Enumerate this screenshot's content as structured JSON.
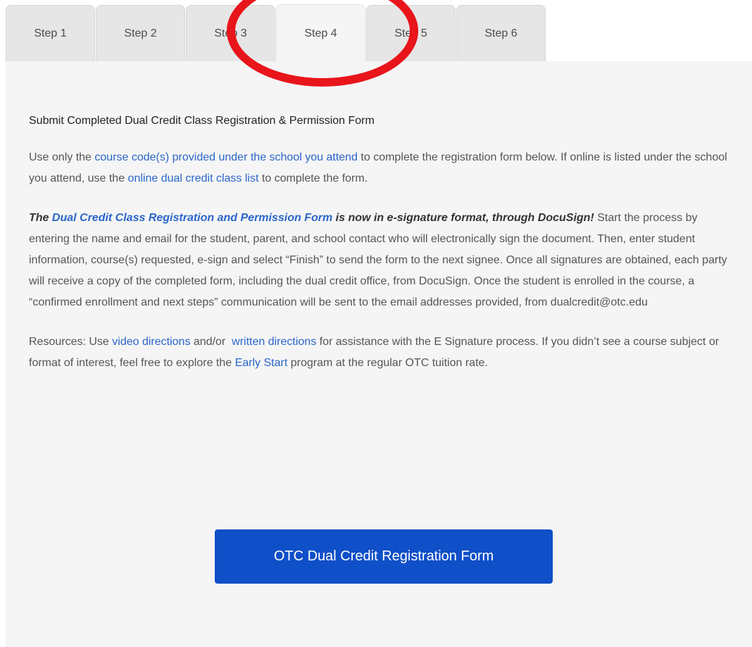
{
  "tabs": [
    {
      "label": "Step 1"
    },
    {
      "label": "Step 2"
    },
    {
      "label": "Step 3"
    },
    {
      "label": "Step 4"
    },
    {
      "label": "Step 5"
    },
    {
      "label": "Step 6"
    }
  ],
  "active_tab": "Step 4",
  "content": {
    "heading": "Submit Completed Dual Credit Class Registration & Permission Form",
    "p1": {
      "t1": "Use only the ",
      "link1": "course code(s) provided under the school you attend",
      "t2": " to complete the registration form below. If online is listed under the school you attend, use the ",
      "link2": "online dual credit class list",
      "t3": " to complete the form."
    },
    "p2": {
      "em1": "The ",
      "link": "Dual Credit Class Registration and Permission Form",
      "em2": " is now in e-signature format, through DocuSign!",
      "text": " Start the process by entering the name and email for the student, parent, and school contact who will electronically sign the document. Then, enter student information, course(s) requested, e-sign and select “Finish” to send the form to the next signee. Once all signatures are obtained, each party will receive a copy of the completed form, including the dual credit office, from DocuSign. Once the student is enrolled in the course, a “confirmed enrollment and next steps” communication will be sent to the email addresses provided, from dualcredit@otc.edu"
    },
    "p3": {
      "t1": "Resources: Use ",
      "link1": "video directions",
      "t2": " and/or  ",
      "link2": "written directions",
      "t3": " for assistance with the E Signature process. If you didn’t see a course subject or format of interest, feel free to explore the ",
      "link3": "Early Start",
      "t4": " program at the regular OTC tuition rate."
    },
    "button_label": "OTC Dual Credit Registration Form"
  },
  "colors": {
    "link": "#2a66c9",
    "button": "#0f4fc8",
    "annotation": "#e8151b"
  }
}
